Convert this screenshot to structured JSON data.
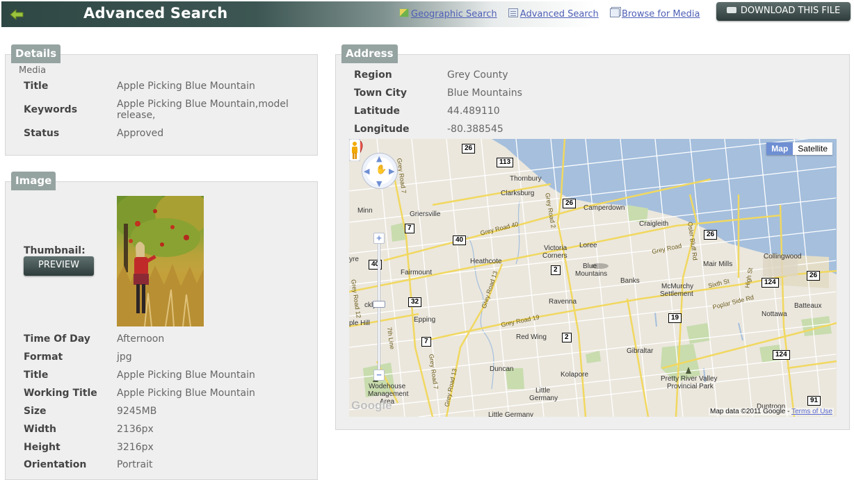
{
  "header": {
    "title": "Advanced Search",
    "nav": [
      {
        "label": "Geographic Search",
        "icon": "map-icon"
      },
      {
        "label": "Advanced Search",
        "icon": "form-icon"
      },
      {
        "label": "Browse for Media",
        "icon": "windows-icon"
      }
    ],
    "download_label": "DOWNLOAD THIS FILE"
  },
  "details": {
    "tab": "Details",
    "media_label": "Media",
    "rows": [
      {
        "key": "Title",
        "value": "Apple Picking Blue Mountain"
      },
      {
        "key": "Keywords",
        "value": "Apple Picking Blue Mountain,model",
        "value2": "release,"
      },
      {
        "key": "Status",
        "value": "Approved"
      }
    ]
  },
  "image": {
    "tab": "Image",
    "thumbnail_label": "Thumbnail:",
    "preview_label": "PREVIEW",
    "rows": [
      {
        "key": "Time Of Day",
        "value": "Afternoon"
      },
      {
        "key": "Format",
        "value": "jpg"
      },
      {
        "key": "Title",
        "value": "Apple Picking Blue Mountain"
      },
      {
        "key": "Working Title",
        "value": "Apple Picking Blue Mountain"
      },
      {
        "key": "Size",
        "value": "9245MB"
      },
      {
        "key": "Width",
        "value": "2136px"
      },
      {
        "key": "Height",
        "value": "3216px"
      },
      {
        "key": "Orientation",
        "value": "Portrait"
      }
    ]
  },
  "address": {
    "tab": "Address",
    "rows": [
      {
        "key": "Region",
        "value": "Grey County"
      },
      {
        "key": "Town City",
        "value": "Blue Mountains"
      },
      {
        "key": "Latitude",
        "value": "44.489110"
      },
      {
        "key": "Longitude",
        "value": "-80.388545"
      }
    ]
  },
  "map": {
    "map_button": "Map",
    "satellite_button": "Satellite",
    "zoom_in": "+",
    "zoom_out": "−",
    "logo": "Google",
    "copyright": "Map data ©2011 Google -",
    "terms": "Terms of Use",
    "places": {
      "thornbury": "Thornbury",
      "clarksburg": "Clarksburg",
      "camperdown": "Camperdown",
      "griersville": "Griersville",
      "craigleith": "Craigleith",
      "collingwood": "Collingwood",
      "mair_mills": "Mair Mills",
      "loree": "Loree",
      "victoria_corners": "Victoria",
      "victoria_corners2": "Corners",
      "heathcote": "Heathcote",
      "fairmount": "Fairmount",
      "mountains": "Mountains",
      "banks": "Banks",
      "mcmurchy": "McMurchy",
      "mcmurchy2": "Settlement",
      "ravenna": "Ravenna",
      "epping": "Epping",
      "red_wing": "Red Wing",
      "nottawa": "Nottawa",
      "batteaux": "Batteaux",
      "gibraltar": "Gibraltar",
      "duncan": "Duncan",
      "kolapore": "Kolapore",
      "little_germany": "Little",
      "little_germany2": "Germany",
      "pretty_river": "Pretty River Valley",
      "pretty_river2": "Provincial Park",
      "wodehouse": "Wodehouse",
      "wodehouse2": "Management",
      "wodehouse3": "Area",
      "dunedin": "Duntroon",
      "little_germany_bottom": "Little Germany",
      "minn": "Minn",
      "yre": "yre",
      "cklyn": "cklyn",
      "ple_hill": "ple Hill",
      "blue": "Blue"
    },
    "roads": {
      "grey_road_40": "Grey Road 40",
      "grey_road_19": "Grey Road 19",
      "grey_road_2": "Grey Road 2",
      "grey_road_7": "Grey Road 7",
      "grey_road_13": "Grey Road 13",
      "grey_road_13b": "Grey Road 13",
      "grey_road_7b": "Grey Road 7",
      "grey_road_12": "Grey Road 12",
      "line_7th": "7th Line",
      "grey_road_21": "Grey Road",
      "osler_bluff": "Osler Bluff Rd",
      "high_st": "High St",
      "sixth_st": "Sixth St",
      "poplar": "Poplar Side Rd"
    },
    "shields": [
      "26",
      "113",
      "26",
      "7",
      "40",
      "2",
      "40",
      "32",
      "7",
      "2",
      "19",
      "26",
      "124",
      "26",
      "124",
      "91"
    ]
  }
}
